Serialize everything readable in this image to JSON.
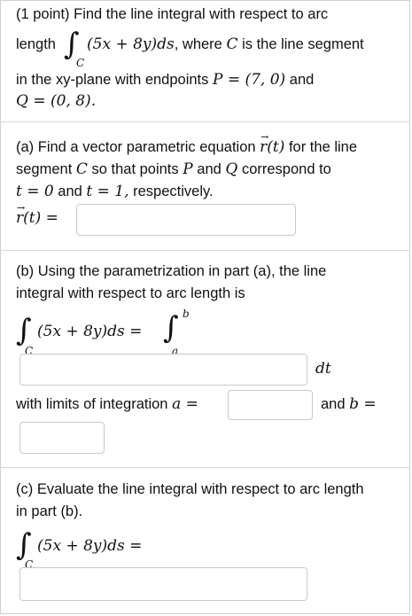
{
  "header": {
    "points": "(1 point)",
    "instruction": "Find the line integral with respect to arc",
    "length_word": "length",
    "integrand": "(5x + 8y)ds",
    "where_text": ", where",
    "curve": "C",
    "is_segment": "is the line segment",
    "plane_text": "in the xy-plane with endpoints",
    "P_def": "P = (7, 0)",
    "and_word": "and",
    "Q_def": "Q = (0, 8)."
  },
  "part_a": {
    "line1": "(a) Find a vector parametric equation",
    "rt": "r(t)",
    "line1_end": "for the line",
    "line2a": "segment",
    "line2b": "so that points",
    "line2c": "and",
    "line2d": "correspond to",
    "t0": "t = 0",
    "and_word": "and",
    "t1": "t = 1,",
    "respectively": "respectively.",
    "answer_label": "r(t) ="
  },
  "part_b": {
    "line1": "(b) Using the parametrization in part (a), the line",
    "line2": "integral with respect to arc length is",
    "lhs": "(5x + 8y)ds =",
    "lower_c": "C",
    "upper_b": "b",
    "lower_a": "a",
    "dt": "dt",
    "limits_text": "with limits of integration",
    "a_eq": "a =",
    "b_text": "and",
    "b_eq": "b ="
  },
  "part_c": {
    "line1": "(c) Evaluate the line integral with respect to arc length",
    "line2": "in part (b).",
    "lhs": "(5x + 8y)ds =",
    "lower_c": "C"
  }
}
